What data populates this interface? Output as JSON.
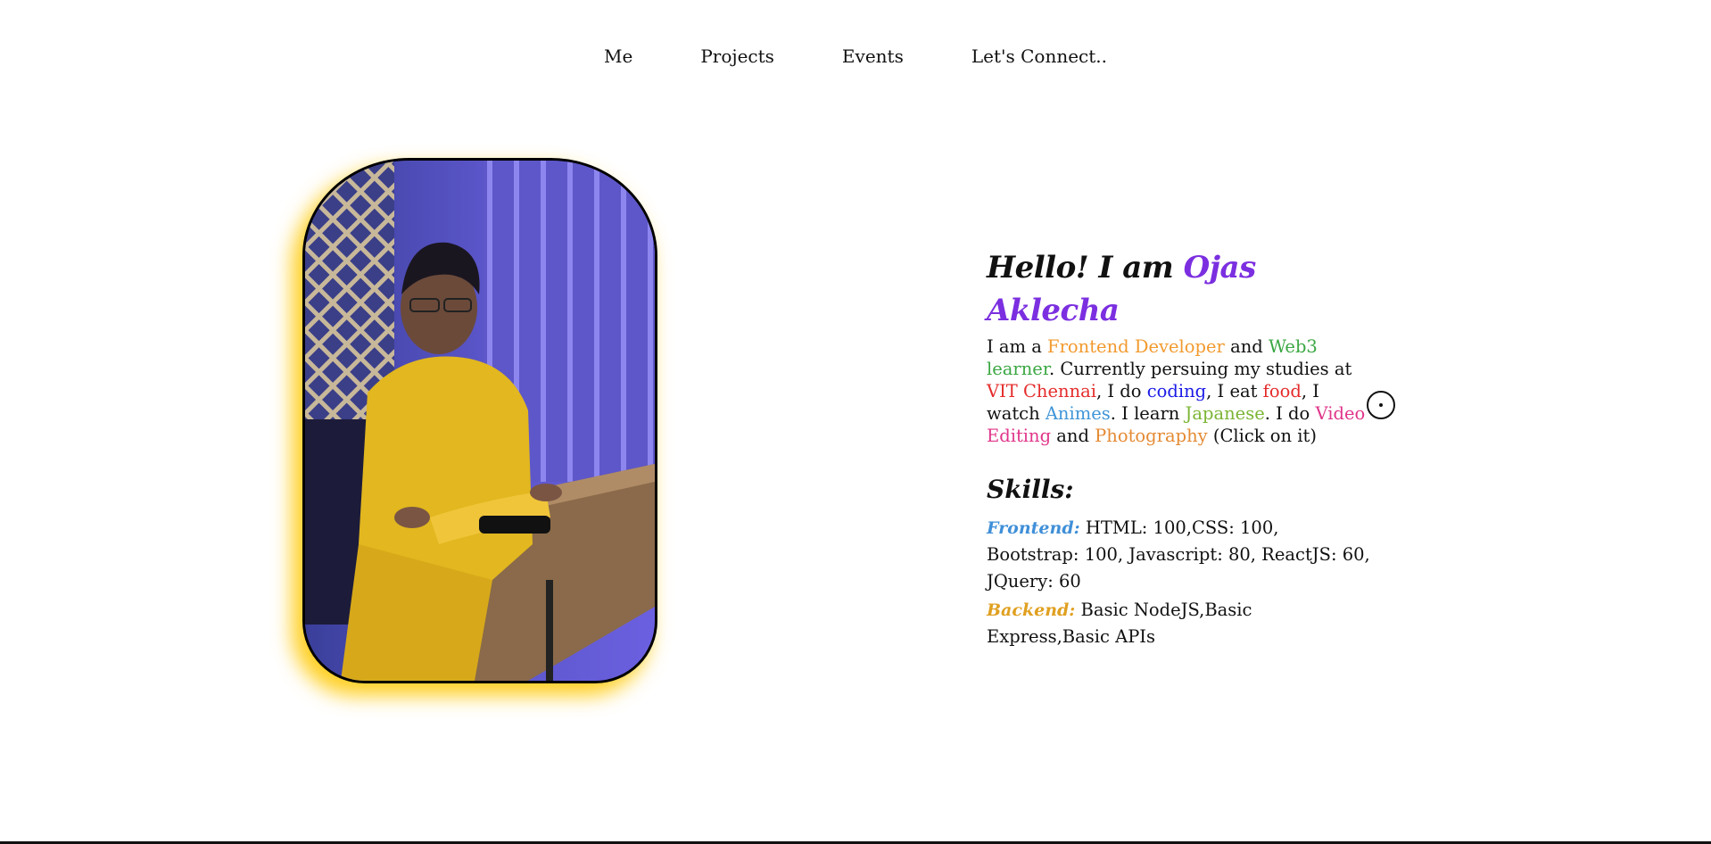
{
  "nav": {
    "items": [
      {
        "label": "Me"
      },
      {
        "label": "Projects"
      },
      {
        "label": "Events"
      },
      {
        "label": "Let's Connect.."
      }
    ]
  },
  "profile_photo": {
    "alt": "Portrait photo in yellow kurta at a wooden table",
    "glow_color": "#ffc800",
    "border_color": "#000000"
  },
  "intro": {
    "greeting": "Hello! I am",
    "name": "Ojas Aklecha",
    "name_color": "#7b2fe0",
    "bio": {
      "t1": "I am a ",
      "role": "Frontend Developer",
      "t2": " and ",
      "web3": "Web3 learner",
      "t3": ". Currently persuing my studies at ",
      "college": "VIT Chennai",
      "t4": ", I do ",
      "coding": "coding",
      "t5": ", I eat ",
      "food": "food",
      "t6": ", I watch ",
      "animes": "Animes",
      "t7": ". I learn ",
      "japanese": "Japanese",
      "t8": ". I do ",
      "video": "Video Editing",
      "t9": " and ",
      "photo": "Photography",
      "t10": " (Click on it)"
    }
  },
  "skills": {
    "title": "Skills:",
    "frontend_label": "Frontend:",
    "frontend_value": "HTML: 100,CSS: 100, Bootstrap: 100, Javascript: 80, ReactJS: 60, JQuery: 60",
    "backend_label": "Backend:",
    "backend_value": "Basic NodeJS,Basic Express,Basic APIs"
  },
  "colors": {
    "frontend_label": "#3f8fd8",
    "backend_label": "#e0a020",
    "orange": "#f29a2e",
    "green": "#3aa742",
    "red": "#e52b2b",
    "blue": "#1a1ae6",
    "sky": "#3f95d8",
    "lime": "#7bb534",
    "pink": "#e0358a",
    "amber": "#e58a32"
  },
  "cursor": {
    "icon": "custom-cursor-ring-icon"
  }
}
